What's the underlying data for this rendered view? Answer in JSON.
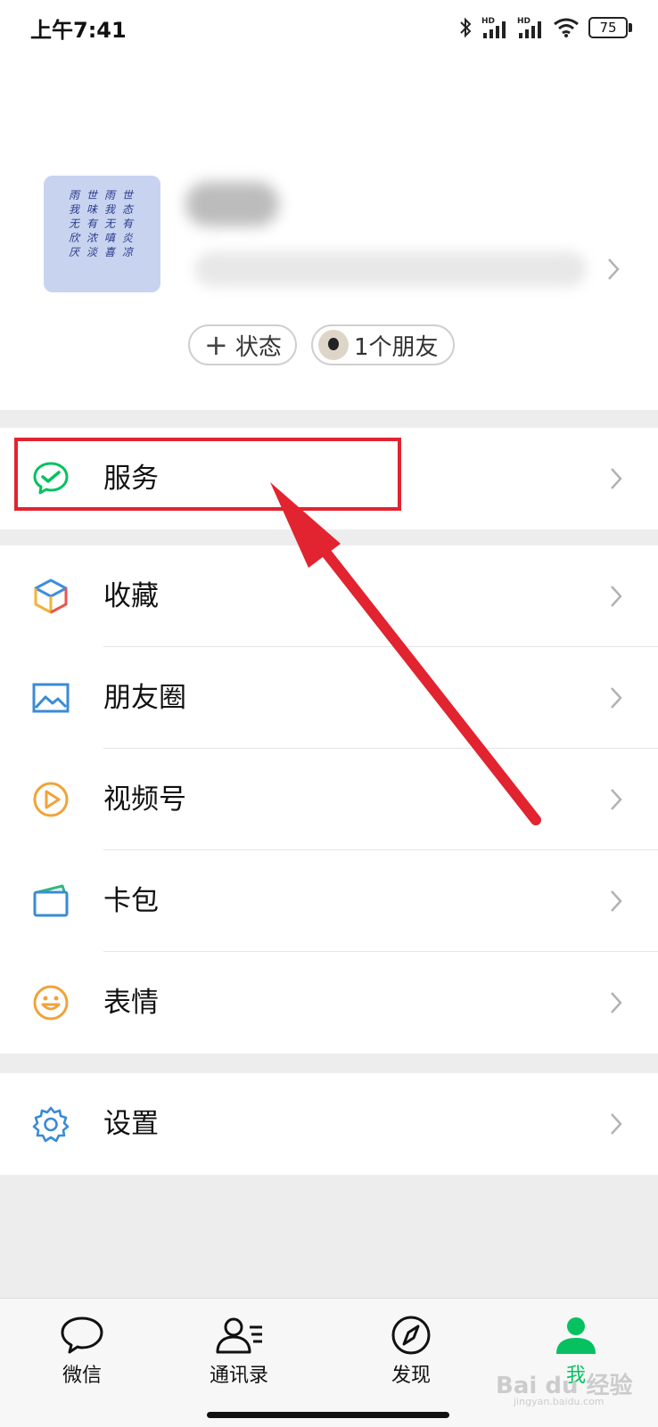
{
  "status_bar": {
    "time": "上午7:41",
    "hd_label_1": "HD",
    "hd_label_2": "HD",
    "battery": "75"
  },
  "profile": {
    "avatar_text": [
      "世态有炎凉",
      "雨我无嗔喜",
      "世味有浓淡",
      "雨我无欣厌"
    ],
    "status_button": "状态",
    "friends_button": "1个朋友"
  },
  "services": {
    "label": "服务",
    "icon": "wechat-pay-icon",
    "color": "#07c160"
  },
  "menu": [
    {
      "label": "收藏",
      "icon": "cube-icon"
    },
    {
      "label": "朋友圈",
      "icon": "image-icon"
    },
    {
      "label": "视频号",
      "icon": "play-circle-icon"
    },
    {
      "label": "卡包",
      "icon": "card-icon"
    },
    {
      "label": "表情",
      "icon": "smiley-icon"
    }
  ],
  "settings": {
    "label": "设置",
    "icon": "gear-icon"
  },
  "tabs": [
    {
      "label": "微信",
      "icon": "chat-bubble-icon"
    },
    {
      "label": "通讯录",
      "icon": "contacts-icon"
    },
    {
      "label": "发现",
      "icon": "compass-icon"
    },
    {
      "label": "我",
      "icon": "person-icon",
      "active": true
    }
  ],
  "watermark": {
    "brand": "Bai du 经验",
    "url": "jingyan.baidu.com"
  },
  "colors": {
    "accent": "#07c160",
    "highlight": "#e22330"
  }
}
